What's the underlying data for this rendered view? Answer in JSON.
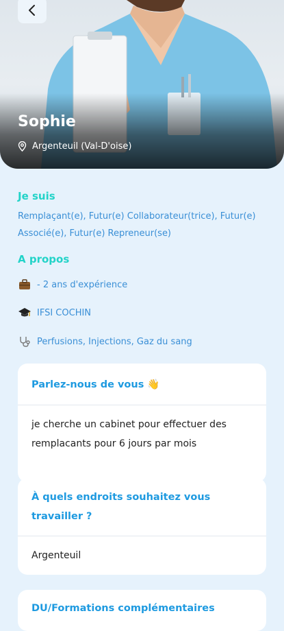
{
  "profile": {
    "name": "Sophie",
    "location": "Argenteuil (Val-D'oise)"
  },
  "je_suis": {
    "title": "Je suis",
    "text": "Remplaçant(e), Futur(e) Collaborateur(trice), Futur(e) Associé(e), Futur(e) Repreneur(se)"
  },
  "a_propos": {
    "title": "A propos",
    "experience": "- 2 ans d'expérience",
    "school": "IFSI COCHIN",
    "skills": "Perfusions, Injections, Gaz du sang"
  },
  "cards": {
    "about_me": {
      "title": "Parlez-nous de vous 👋",
      "text": "je cherche un cabinet pour effectuer des remplacants pour 6 jours par mois"
    },
    "locations": {
      "title": "À quels endroits souhaitez vous travailler ?",
      "text": "Argenteuil"
    },
    "trainings": {
      "title": "DU/Formations complémentaires"
    }
  },
  "colors": {
    "accent_teal": "#22d3c8",
    "link_blue": "#3a8fd6",
    "card_title_blue": "#1e9ae0",
    "background": "#e6f2fc"
  }
}
